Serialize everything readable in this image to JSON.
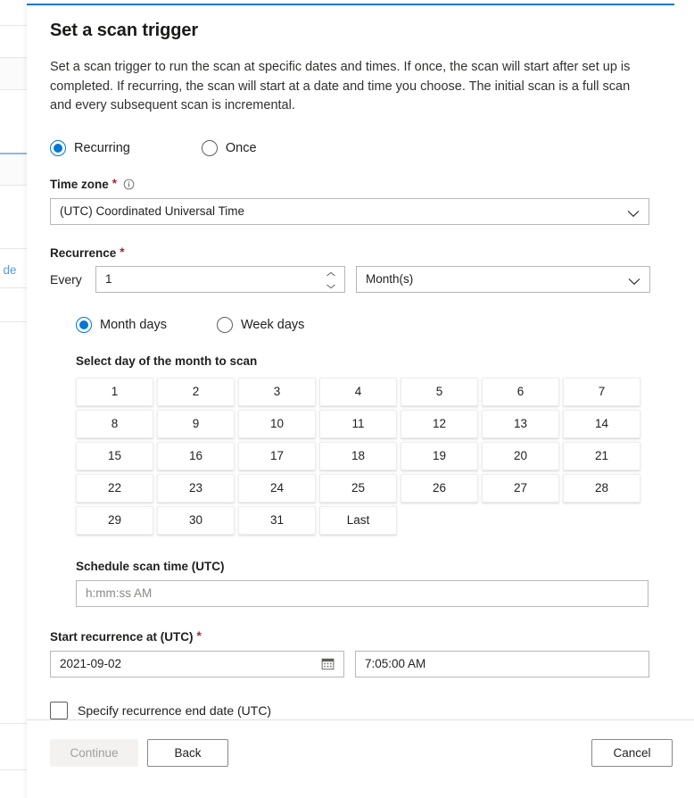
{
  "background": {
    "link_text": "w de"
  },
  "panel": {
    "title": "Set a scan trigger",
    "description": "Set a scan trigger to run the scan at specific dates and times. If once, the scan will start after set up is completed. If recurring, the scan will start at a date and time you choose. The initial scan is a full scan and every subsequent scan is incremental.",
    "accent_color": "#0078d4"
  },
  "trigger_type": {
    "options": [
      {
        "label": "Recurring",
        "selected": true
      },
      {
        "label": "Once",
        "selected": false
      }
    ]
  },
  "time_zone": {
    "label": "Time zone",
    "required_marker": "*",
    "info_icon": "info-circle-icon",
    "value": "(UTC) Coordinated Universal Time",
    "chevron_icon": "chevron-down-icon"
  },
  "recurrence": {
    "label": "Recurrence",
    "required_marker": "*",
    "every_label": "Every",
    "interval_value": "1",
    "spinner_icon": "spinner-up-down-icon",
    "unit_value": "Month(s)",
    "unit_chevron_icon": "chevron-down-icon",
    "mode_options": [
      {
        "label": "Month days",
        "selected": true
      },
      {
        "label": "Week days",
        "selected": false
      }
    ]
  },
  "day_picker": {
    "label": "Select day of the month to scan",
    "days": [
      "1",
      "2",
      "3",
      "4",
      "5",
      "6",
      "7",
      "8",
      "9",
      "10",
      "11",
      "12",
      "13",
      "14",
      "15",
      "16",
      "17",
      "18",
      "19",
      "20",
      "21",
      "22",
      "23",
      "24",
      "25",
      "26",
      "27",
      "28",
      "29",
      "30",
      "31",
      "Last"
    ]
  },
  "schedule_time": {
    "label": "Schedule scan time (UTC)",
    "placeholder": "h:mm:ss AM",
    "value": ""
  },
  "start_recurrence": {
    "label": "Start recurrence at (UTC)",
    "required_marker": "*",
    "date_value": "2021-09-02",
    "calendar_icon": "calendar-icon",
    "time_value": "7:05:00 AM"
  },
  "end_date": {
    "label": "Specify recurrence end date (UTC)",
    "checked": false
  },
  "footer": {
    "continue_label": "Continue",
    "continue_disabled": true,
    "back_label": "Back",
    "cancel_label": "Cancel"
  }
}
